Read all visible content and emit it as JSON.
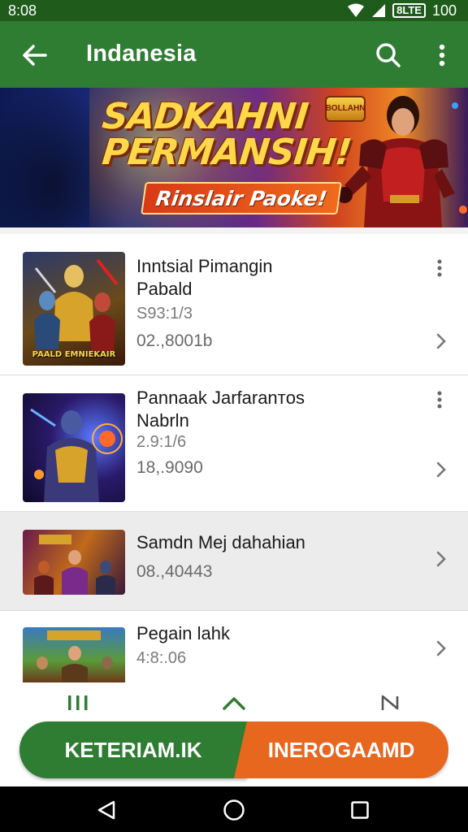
{
  "status_bar": {
    "time": "8:08",
    "battery": "8LTE",
    "level": "100"
  },
  "app_bar": {
    "title": "Indanesia"
  },
  "banner": {
    "title_line1": "SADKAHNI",
    "title_line2": "PERMANSIH!",
    "tagline": "Rinslair Paoke!",
    "logo_text": "BOLLAHN"
  },
  "games": [
    {
      "title": "Inntsial Pimangin",
      "subtitle": "Pabald",
      "version": "S93:1/3",
      "count": "02.,8001b",
      "thumb_caption": "PAALD EMNIEKAIR",
      "has_menu": true
    },
    {
      "title": "Pannaak Jarfaranᴛᴏs",
      "subtitle": "Nabrln",
      "version": "2.9:1/6",
      "count": "18,.9090",
      "thumb_caption": "",
      "has_menu": true
    },
    {
      "title": "Samdn Mej dahahian",
      "subtitle": "",
      "version": "",
      "count": "08.,40443",
      "thumb_caption": "",
      "has_menu": false
    },
    {
      "title": "Pegain lahk",
      "subtitle": "",
      "version": "4:8:.06",
      "count": "",
      "thumb_caption": "",
      "has_menu": false
    }
  ],
  "bottom_buttons": {
    "left": "KETERIAM.IK",
    "right": "INEROGAAMD"
  },
  "colors": {
    "primary": "#2e7d32",
    "status": "#1f5c1c",
    "accent": "#e8671e"
  }
}
